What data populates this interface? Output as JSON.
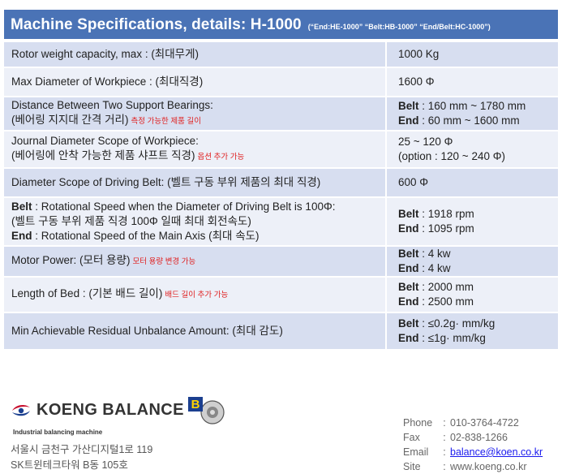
{
  "header": {
    "title": "Machine Specifications, details: H-1000",
    "subtitle": "(“End:HE-1000”  “Belt:HB-1000”  “End/Belt:HC-1000”)"
  },
  "specs": [
    {
      "label_lines": [
        "Rotor weight capacity, max : (최대무게)"
      ],
      "value_lines": [
        [
          "",
          "1000 Kg"
        ]
      ]
    },
    {
      "label_lines": [
        "Max Diameter of Workpiece  : (최대직경)"
      ],
      "value_lines": [
        [
          "",
          "1600 Φ"
        ]
      ]
    },
    {
      "label_lines": [
        "Distance Between Two Support Bearings:",
        "(베어링 지지대 간격 거리)"
      ],
      "note": "측정 가능한 제품 길이",
      "value_lines": [
        [
          "Belt",
          " : 160 mm ~ 1780 mm"
        ],
        [
          "End",
          " : 60 mm ~ 1600 mm"
        ]
      ]
    },
    {
      "label_lines": [
        "Journal Diameter Scope of Workpiece:",
        "(베어링에 안착 가능한 제품 샤프트 직경)"
      ],
      "note": "옵션 추가 가능",
      "value_lines": [
        [
          "",
          " 25 ~ 120 Φ"
        ],
        [
          "",
          "(option : 120 ~ 240 Φ)"
        ]
      ]
    },
    {
      "label_lines": [
        "Diameter Scope of Driving Belt: (벨트 구동 부위 제품의 최대 직경)"
      ],
      "value_lines": [
        [
          "",
          "600 Φ"
        ]
      ]
    },
    {
      "label_rich": [
        [
          "Belt",
          " : Rotational Speed when the Diameter of Driving Belt is 100Φ:"
        ],
        [
          "",
          "(벨트 구동 부위 제품 직경 100Φ 일때 최대 회전속도)"
        ],
        [
          "End",
          " : Rotational Speed of the Main Axis (최대 속도)"
        ]
      ],
      "value_lines": [
        [
          "Belt",
          " : 1918 rpm"
        ],
        [
          "End",
          " : 1095 rpm"
        ]
      ]
    },
    {
      "label_lines": [
        "Motor Power: (모터 용량)"
      ],
      "note": "모터 용량 변경 가능",
      "value_lines": [
        [
          "Belt",
          " : 4 kw"
        ],
        [
          "End",
          " : 4 kw"
        ]
      ]
    },
    {
      "label_lines": [
        "Length of Bed : (기본 배드 길이)"
      ],
      "note": "배드 길이 추가 가능",
      "value_lines": [
        [
          "Belt",
          " : 2000 mm"
        ],
        [
          "End",
          " : 2500 mm"
        ]
      ]
    },
    {
      "label_lines": [
        "Min Achievable Residual Unbalance Amount: (최대 감도)"
      ],
      "value_lines": [
        [
          "Belt",
          " : ≤0.2g· mm/kg"
        ],
        [
          "End",
          " : ≤1g· mm/kg"
        ]
      ]
    }
  ],
  "footer": {
    "logo_text": "KOENG BALANCE",
    "logo_badge": "B",
    "tagline": "Industrial balancing machine",
    "address_line1": "서울시 금천구 가산디지털1로 119",
    "address_line2": "SK트윈테크타워 B동 105호",
    "contact": [
      {
        "key": "Phone",
        "sep": ":",
        "value": "010-3764-4722",
        "link": false
      },
      {
        "key": "Fax",
        "sep": ":",
        "value": "02-838-1266",
        "link": false
      },
      {
        "key": "Email",
        "sep": ":",
        "value": "balance@koen.co.kr",
        "link": true
      },
      {
        "key": "Site",
        "sep": ":",
        "value": "www.koeng.co.kr",
        "link": false
      }
    ],
    "colors": {
      "title_bar": "#4a73b6",
      "row_shade": "#d7def0",
      "row_light": "#edf0f8",
      "note": "#e02020",
      "logo_red": "#c8102e",
      "logo_blue": "#1b3f8f"
    }
  }
}
